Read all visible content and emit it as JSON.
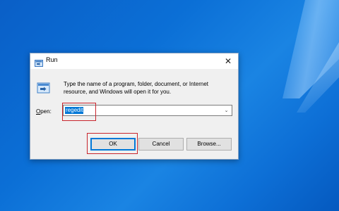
{
  "window": {
    "title": "Run",
    "close_glyph": "✕"
  },
  "dialog": {
    "description": "Type the name of a program, folder, document, or Internet resource, and Windows will open it for you.",
    "open_label_prefix": "O",
    "open_label_rest": "pen:",
    "open_value": "regedit",
    "combo_arrow_glyph": "⌄"
  },
  "buttons": {
    "ok": "OK",
    "cancel": "Cancel",
    "browse": "Browse..."
  },
  "colors": {
    "desktop_blue": "#0b6fd6",
    "selection_blue": "#0078d7",
    "annotation_red": "#c8252c"
  },
  "icons": {
    "title_icon": "run-icon",
    "app_icon": "run-program-icon"
  }
}
